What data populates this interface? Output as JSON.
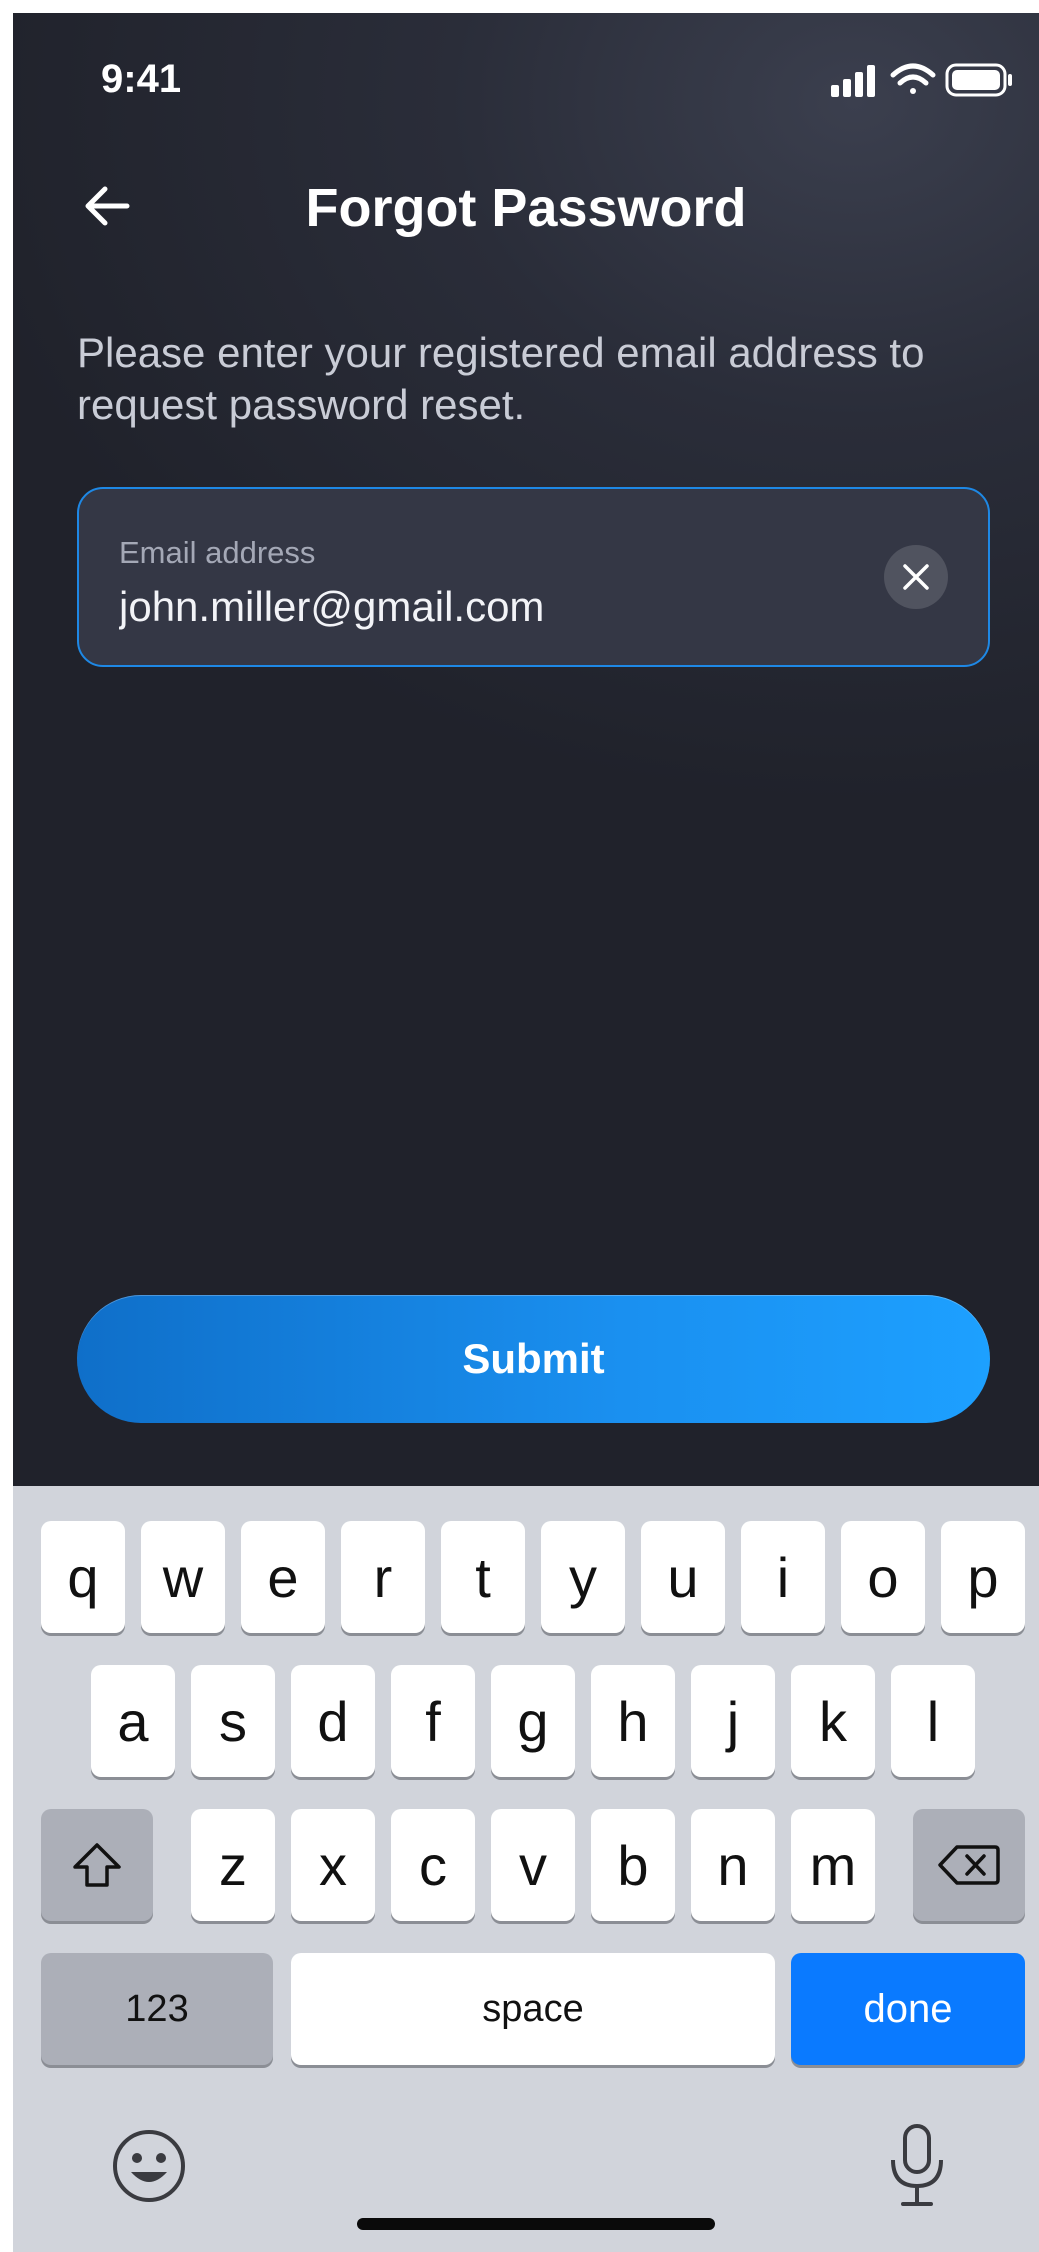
{
  "status_bar": {
    "time": "9:41"
  },
  "header": {
    "title": "Forgot Password"
  },
  "instruction": "Please enter your registered email address to request password reset.",
  "email_field": {
    "label": "Email address",
    "value": "john.miller@gmail.com"
  },
  "submit_label": "Submit",
  "keyboard": {
    "row1": [
      "q",
      "w",
      "e",
      "r",
      "t",
      "y",
      "u",
      "i",
      "o",
      "p"
    ],
    "row2": [
      "a",
      "s",
      "d",
      "f",
      "g",
      "h",
      "j",
      "k",
      "l"
    ],
    "row3": [
      "z",
      "x",
      "c",
      "v",
      "b",
      "n",
      "m"
    ],
    "numbers_label": "123",
    "space_label": "space",
    "done_label": "done"
  },
  "icons": {
    "back": "arrow-left-icon",
    "clear": "close-icon",
    "shift": "shift-icon",
    "backspace": "backspace-icon",
    "emoji": "emoji-icon",
    "mic": "microphone-icon"
  },
  "colors": {
    "accent": "#1e88e5",
    "button_gradient_start": "#0f6fc9",
    "button_gradient_end": "#1da0ff",
    "done_key": "#0a7aff",
    "background": "#2a2d39"
  }
}
